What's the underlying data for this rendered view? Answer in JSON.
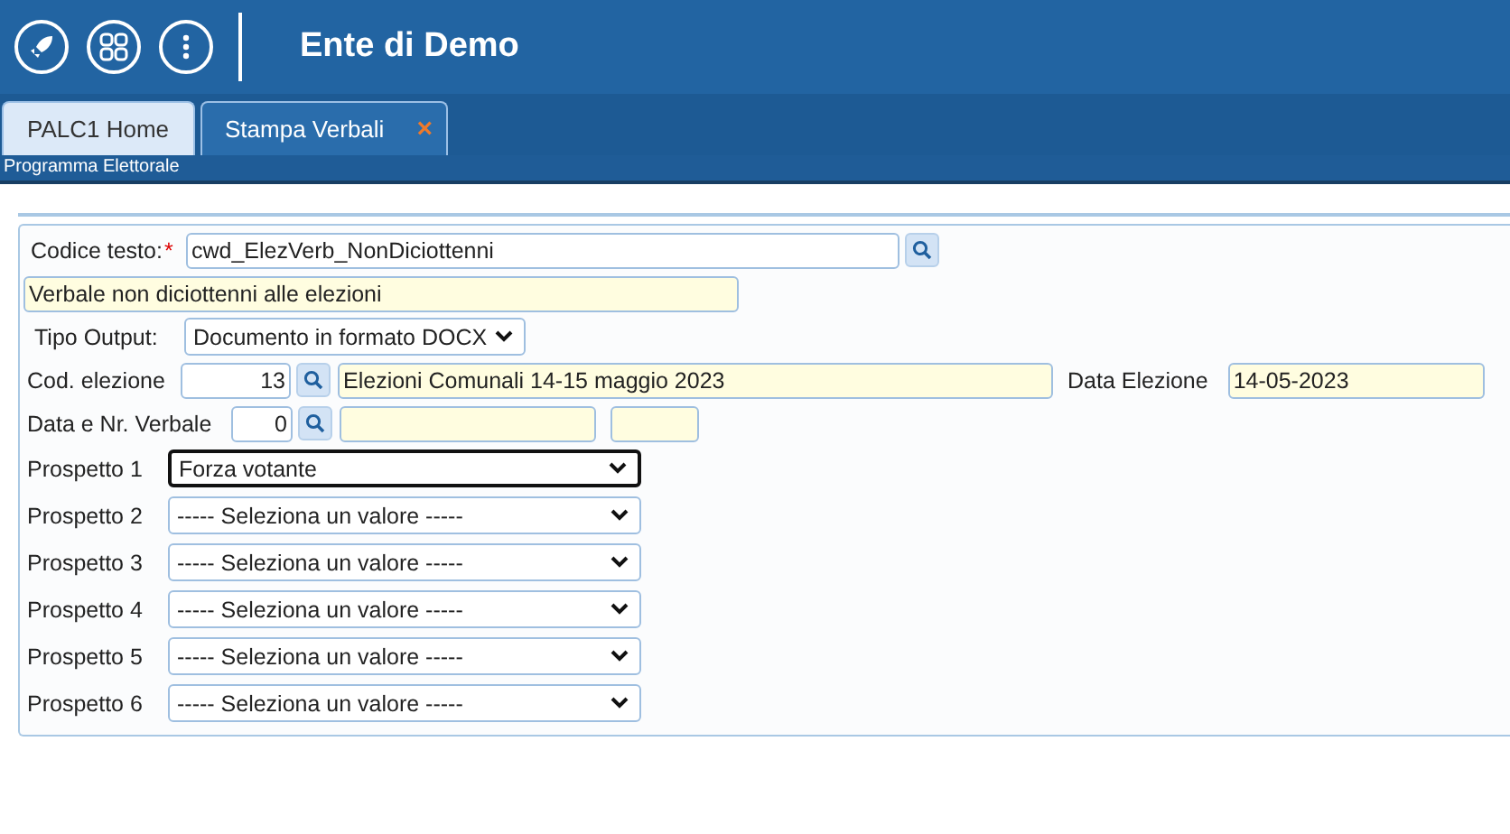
{
  "header": {
    "title": "Ente di Demo"
  },
  "tabs": [
    {
      "label": "PALC1 Home",
      "selected": false
    },
    {
      "label": "Stampa Verbali",
      "selected": true,
      "close": "×"
    }
  ],
  "subtitle": "Programma Elettorale",
  "form": {
    "codice_testo": {
      "label": "Codice testo:",
      "required_mark": "*",
      "value": "cwd_ElezVerb_NonDiciottenni"
    },
    "descrizione": {
      "value": "Verbale non diciottenni alle elezioni"
    },
    "tipo_output": {
      "label": "Tipo Output:",
      "value": "Documento in formato DOCX"
    },
    "cod_elezione": {
      "label": "Cod. elezione",
      "value": "13",
      "description": "Elezioni Comunali 14-15 maggio 2023",
      "date_label": "Data Elezione",
      "date": "14-05-2023"
    },
    "verbale": {
      "label": "Data e Nr. Verbale",
      "value": "0"
    },
    "prospetti": [
      {
        "label": "Prospetto 1",
        "value": "Forza votante",
        "focused": true
      },
      {
        "label": "Prospetto 2",
        "value": "----- Seleziona un valore -----",
        "focused": false
      },
      {
        "label": "Prospetto 3",
        "value": "----- Seleziona un valore -----",
        "focused": false
      },
      {
        "label": "Prospetto 4",
        "value": "----- Seleziona un valore -----",
        "focused": false
      },
      {
        "label": "Prospetto 5",
        "value": "----- Seleziona un valore -----",
        "focused": false
      },
      {
        "label": "Prospetto 6",
        "value": "----- Seleziona un valore -----",
        "focused": false
      }
    ]
  }
}
